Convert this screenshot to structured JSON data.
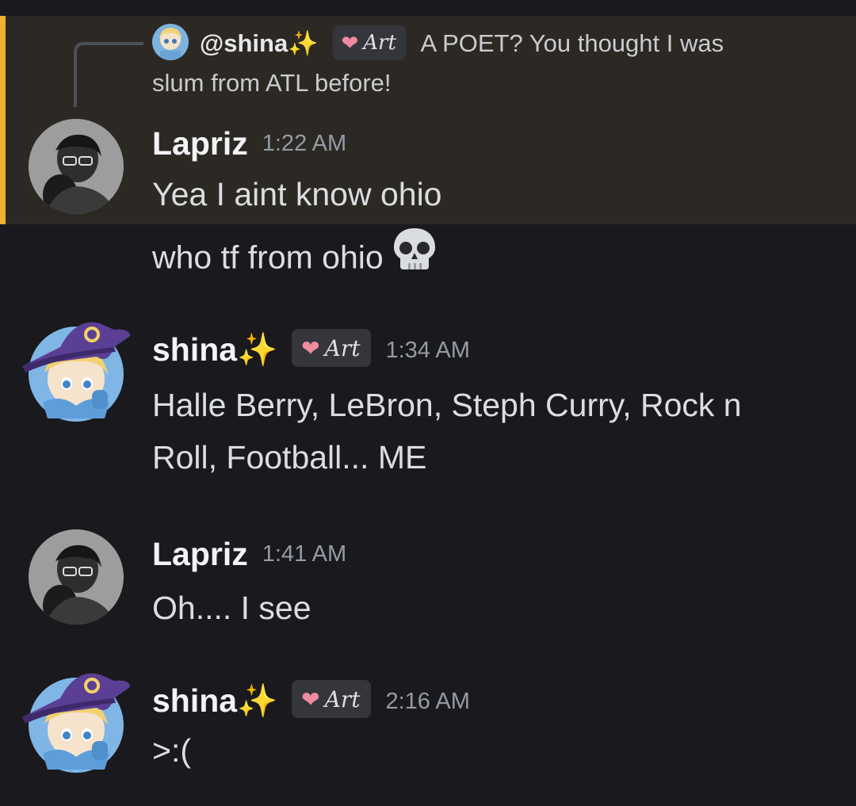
{
  "reply": {
    "mention": "@shina",
    "badge": "Art",
    "text_line1": "A POET? You thought I was",
    "text_line2": "slum from ATL before!"
  },
  "messages": [
    {
      "author": "Lapriz",
      "time": "1:22 AM",
      "lines": [
        "Yea I aint know ohio"
      ]
    },
    {
      "continuation": "who tf from ohio"
    },
    {
      "author": "shina",
      "badge": "Art",
      "time": "1:34 AM",
      "lines": [
        "Halle Berry, LeBron, Steph Curry, Rock n",
        "Roll, Football... ME"
      ]
    },
    {
      "author": "Lapriz",
      "time": "1:41 AM",
      "lines": [
        "Oh.... I see"
      ]
    },
    {
      "author": "shina",
      "badge": "Art",
      "time": "2:16 AM",
      "lines": [
        ">:("
      ]
    }
  ],
  "icons": {
    "sparkles": "sparkles-icon",
    "heart": "heart-icon",
    "skull": "skull-icon"
  },
  "colors": {
    "background": "#1a1a1e",
    "highlight": "#2c2924",
    "highlight_bar": "#f0b232",
    "timestamp": "#949ba4"
  }
}
